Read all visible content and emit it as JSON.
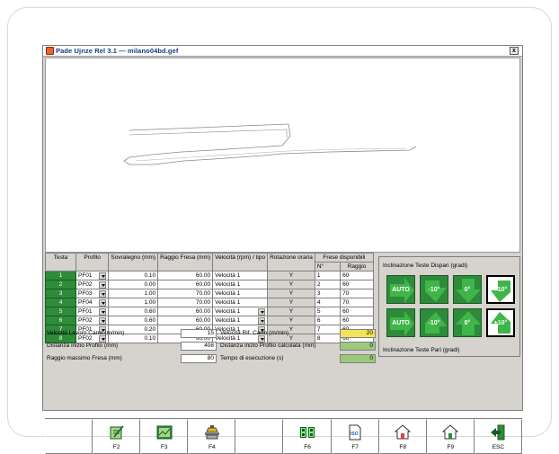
{
  "window": {
    "title": "Pade Ujnze Rel 3.1 — milano04bd.gef",
    "close_label": "x"
  },
  "table": {
    "headers": {
      "testa": "Testa",
      "profilo": "Profilo",
      "sovralegno": "Sovralegno (mm)",
      "raggio_fresa": "Raggio Fresa (mm)",
      "velocita": "Velocità (rpm) / tipo",
      "rotazione": "Rotazione oraria",
      "frese": "Frese disponibili",
      "n": "N°",
      "raggio": "Raggio"
    },
    "rows": [
      {
        "testa": "1",
        "profilo": "PF01",
        "sovralegno": "0.10",
        "raggio": "60.00",
        "velocita": "Velocità 1",
        "rot": "Y",
        "n": "1",
        "fr": "60"
      },
      {
        "testa": "2",
        "profilo": "PF02",
        "sovralegno": "0.00",
        "raggio": "60.00",
        "velocita": "Velocità 1",
        "rot": "Y",
        "n": "2",
        "fr": "60"
      },
      {
        "testa": "3",
        "profilo": "PF03",
        "sovralegno": "1.00",
        "raggio": "70.00",
        "velocita": "Velocità 1",
        "rot": "Y",
        "n": "3",
        "fr": "70"
      },
      {
        "testa": "4",
        "profilo": "PF04",
        "sovralegno": "1.00",
        "raggio": "70.00",
        "velocita": "Velocità 1",
        "rot": "Y",
        "n": "4",
        "fr": "70"
      },
      {
        "testa": "5",
        "profilo": "PF01",
        "sovralegno": "0.60",
        "raggio": "60.00",
        "velocita": "Velocità 1",
        "rot": "Y",
        "n": "5",
        "fr": "60"
      },
      {
        "testa": "6",
        "profilo": "PF02",
        "sovralegno": "0.60",
        "raggio": "60.00",
        "velocita": "Velocità 1",
        "rot": "Y",
        "n": "6",
        "fr": "60"
      },
      {
        "testa": "7",
        "profilo": "PF01",
        "sovralegno": "0.20",
        "raggio": "60.00",
        "velocita": "Velocità 1",
        "rot": "Y",
        "n": "7",
        "fr": "60"
      },
      {
        "testa": "8",
        "profilo": "PF02",
        "sovralegno": "0.10",
        "raggio": "60.00",
        "velocita": "Velocità 1",
        "rot": "Y",
        "n": "8",
        "fr": "60"
      }
    ]
  },
  "inclinazione": {
    "title_dispari": "Inclinazione Teste Dispari (gradi)",
    "title_pari": "Inclinazione Teste Pari (gradi)",
    "dispari": [
      "AUTO",
      "-10°",
      "0°",
      "+10°"
    ],
    "pari": [
      "AUTO",
      "-10°",
      "0°",
      "+10°"
    ]
  },
  "params": {
    "vel_lavoro_label": "Velocità Lavoro Carro (m/min)",
    "vel_lavoro": "15",
    "dist_label": "Distanza inizio Profilo (mm)",
    "dist": "408",
    "raggio_label": "Raggio massimo Fresa (mm)",
    "raggio": "80",
    "vel_rif_label": "Velocità Rif. Carro (m/min)",
    "vel_rif": "20",
    "dist_calc_label": "Distanza inizio Profilo calcolata (mm)",
    "dist_calc": "0",
    "tempo_label": "Tempo di esecuzione (s)",
    "tempo": "0"
  },
  "fkeys": [
    {
      "label": "",
      "icon": ""
    },
    {
      "label": "F2",
      "icon": "edit-icon"
    },
    {
      "label": "F3",
      "icon": "chart-icon"
    },
    {
      "label": "F4",
      "icon": "machine-icon"
    },
    {
      "label": "",
      "icon": ""
    },
    {
      "label": "F6",
      "icon": "display-icon"
    },
    {
      "label": "F7",
      "icon": "iso-icon"
    },
    {
      "label": "F8",
      "icon": "home-icon"
    },
    {
      "label": "F9",
      "icon": "home-icon"
    },
    {
      "label": "ESC",
      "icon": "exit-icon"
    }
  ],
  "colors": {
    "head_green": "#2e8b3a",
    "yellow": "#f4e35a",
    "light_green": "#9cc87c"
  }
}
